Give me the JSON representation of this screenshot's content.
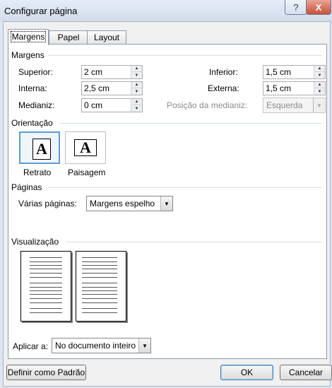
{
  "window": {
    "title": "Configurar página",
    "help": "?",
    "close": "X"
  },
  "tabs": [
    "Margens",
    "Papel",
    "Layout"
  ],
  "margins": {
    "group_title": "Margens",
    "superior": {
      "label": "Superior:",
      "value": "2 cm"
    },
    "inferior": {
      "label": "Inferior:",
      "value": "1,5 cm"
    },
    "interna": {
      "label": "Interna:",
      "value": "2,5 cm"
    },
    "externa": {
      "label": "Externa:",
      "value": "1,5 cm"
    },
    "medianiz": {
      "label": "Medianiz:",
      "value": "0 cm"
    },
    "posicao_medianiz": {
      "label": "Posição da medianiz:",
      "value": "Esquerda"
    }
  },
  "orientation": {
    "group_title": "Orientação",
    "portrait": {
      "label": "Retrato",
      "glyph": "A"
    },
    "landscape": {
      "label": "Paisagem",
      "glyph": "A"
    }
  },
  "pages": {
    "group_title": "Páginas",
    "multiple_label": "Várias páginas:",
    "multiple_value": "Margens espelho"
  },
  "preview": {
    "group_title": "Visualização"
  },
  "apply": {
    "label": "Aplicar a:",
    "value": "No documento inteiro"
  },
  "buttons": {
    "default": "Definir como Padrão",
    "ok": "OK",
    "cancel": "Cancelar"
  },
  "colors": {
    "title_bar": "#dde6f1",
    "close_button": "#c7503b",
    "selected_border": "#5b9bd5"
  }
}
